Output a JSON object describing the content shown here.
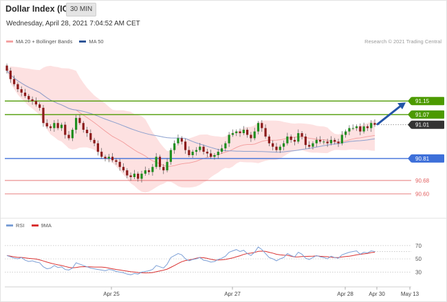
{
  "header": {
    "title": "Dollar Index (ICE)",
    "interval": "30 MIN",
    "timestamp": "Wednesday, April 28, 2021 7:04:52 AM CET"
  },
  "credit": "Research © 2021 Trading Central",
  "legend": {
    "main": [
      {
        "label": "MA 20 + Bollinger Bands",
        "color": "#f4a3a3"
      },
      {
        "label": "MA 50",
        "color": "#2f5597"
      }
    ],
    "rsi": [
      {
        "label": "RSI",
        "color": "#7b9fd6"
      },
      {
        "label": "9MA",
        "color": "#d93030"
      }
    ]
  },
  "colors": {
    "up": "#1e8e1e",
    "down": "#8b1a1a",
    "resistance": "#4c9a00",
    "support": "#3d6fd9",
    "minor": "#e26060",
    "arrow": "#2455a8",
    "last": "#333333"
  },
  "chart_data": [
    {
      "type": "candlestick",
      "title": "Dollar Index (ICE)",
      "x_ticks": [
        "Apr 25",
        "Apr 27",
        "Apr 28",
        "Apr 30",
        "May 13"
      ],
      "ylim": [
        90.57,
        91.35
      ],
      "bar_count": 102,
      "close": [
        91.33,
        91.28,
        91.25,
        91.22,
        91.2,
        91.18,
        91.16,
        91.15,
        91.13,
        91.11,
        91.02,
        91.0,
        90.99,
        91.02,
        90.99,
        91.01,
        90.95,
        90.93,
        90.98,
        91.05,
        91.02,
        90.98,
        90.96,
        90.92,
        90.9,
        90.85,
        90.82,
        90.81,
        90.82,
        90.8,
        90.79,
        90.76,
        90.74,
        90.71,
        90.7,
        90.72,
        90.69,
        90.72,
        90.74,
        90.73,
        90.76,
        90.82,
        90.76,
        90.74,
        90.79,
        90.86,
        90.9,
        90.93,
        90.91,
        90.86,
        90.83,
        90.85,
        90.86,
        90.88,
        90.85,
        90.84,
        90.82,
        90.83,
        90.85,
        90.87,
        90.9,
        90.95,
        90.96,
        90.97,
        90.96,
        90.98,
        90.95,
        90.93,
        90.97,
        91.02,
        90.99,
        90.94,
        90.9,
        90.88,
        90.86,
        90.88,
        90.9,
        90.94,
        90.92,
        90.91,
        90.96,
        90.94,
        90.89,
        90.88,
        90.9,
        90.92,
        90.91,
        90.91,
        90.9,
        90.92,
        90.91,
        90.9,
        90.95,
        90.97,
        90.99,
        90.99,
        91.0,
        90.97,
        91.0,
        90.99,
        91.02,
        91.01
      ],
      "levels": [
        {
          "label": "91.15",
          "value": 91.15,
          "kind": "resistance"
        },
        {
          "label": "91.07",
          "value": 91.07,
          "kind": "resistance"
        },
        {
          "label": "91.01",
          "value": 91.01,
          "kind": "last"
        },
        {
          "label": "90.81",
          "value": 90.81,
          "kind": "support"
        },
        {
          "label": "90.68",
          "value": 90.68,
          "kind": "minor"
        },
        {
          "label": "90.60",
          "value": 90.6,
          "kind": "minor"
        }
      ],
      "forecast_arrow": {
        "from": 91.01,
        "to": 91.15
      }
    },
    {
      "type": "line",
      "series": [
        {
          "name": "RSI"
        },
        {
          "name": "9MA"
        }
      ],
      "ylim": [
        18,
        75
      ],
      "y_ticks": [
        "70",
        "50",
        "30"
      ],
      "rsi": [
        55,
        53,
        51,
        50,
        52,
        48,
        46,
        47,
        45,
        44,
        38,
        35,
        36,
        40,
        37,
        38,
        34,
        33,
        36,
        44,
        42,
        40,
        38,
        36,
        35,
        34,
        33,
        32,
        34,
        33,
        31,
        30,
        29,
        27,
        26,
        28,
        27,
        30,
        31,
        32,
        34,
        40,
        38,
        36,
        42,
        52,
        55,
        58,
        56,
        50,
        47,
        49,
        50,
        52,
        48,
        47,
        45,
        46,
        49,
        51,
        54,
        60,
        62,
        64,
        61,
        63,
        58,
        55,
        60,
        68,
        64,
        58,
        52,
        50,
        47,
        50,
        52,
        58,
        55,
        53,
        60,
        57,
        51,
        49,
        52,
        55,
        53,
        52,
        50,
        54,
        52,
        51,
        56,
        58,
        60,
        61,
        62,
        57,
        60,
        59,
        62,
        61
      ]
    }
  ]
}
